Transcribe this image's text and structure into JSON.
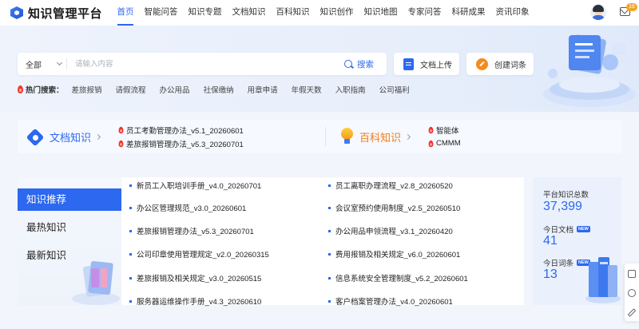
{
  "brand": {
    "name": "知识管理平台"
  },
  "nav": {
    "items": [
      {
        "label": "首页",
        "active": true
      },
      {
        "label": "智能问答"
      },
      {
        "label": "知识专题"
      },
      {
        "label": "文档知识"
      },
      {
        "label": "百科知识"
      },
      {
        "label": "知识创作"
      },
      {
        "label": "知识地图"
      },
      {
        "label": "专家问答"
      },
      {
        "label": "科研成果"
      },
      {
        "label": "资讯印象"
      }
    ]
  },
  "header": {
    "mail_badge": "16"
  },
  "search": {
    "category": "全部",
    "placeholder": "请输入内容",
    "button_label": "搜索"
  },
  "actions": {
    "upload_label": "文档上传",
    "create_label": "创建词条"
  },
  "hot": {
    "label": "热门搜索：",
    "tags": [
      "差旅报销",
      "请假流程",
      "办公用品",
      "社保缴纳",
      "用章申请",
      "年假天数",
      "入职指南",
      "公司福利"
    ]
  },
  "doc_knowledge": {
    "title": "文档知识",
    "items": [
      "员工考勤管理办法_v5.1_20260601",
      "差旅报销管理办法_v5.3_20260701"
    ]
  },
  "baike_knowledge": {
    "title": "百科知识",
    "items": [
      "智能体",
      "CMMM"
    ]
  },
  "tabs": [
    "知识推荐",
    "最热知识",
    "最新知识"
  ],
  "docs": {
    "left": [
      "新员工入职培训手册_v4.0_20260701",
      "办公区管理规范_v3.0_20260601",
      "差旅报销管理办法_v5.3_20260701",
      "公司印章使用管理规定_v2.0_20260315",
      "差旅报销及相关规定_v3.0_20260515",
      "服务器运维操作手册_v4.3_20260610"
    ],
    "right": [
      "员工离职办理流程_v2.8_20260520",
      "会议室预约使用制度_v2.5_20260510",
      "办公用品申领流程_v3.1_20260420",
      "费用报销及相关规定_v6.0_20260601",
      "信息系统安全管理制度_v5.2_20260601",
      "客户档案管理办法_v4.0_20260601"
    ]
  },
  "stats": {
    "total_label": "平台知识总数",
    "total_value": "37,399",
    "docs_label": "今日文档",
    "docs_value": "41",
    "terms_label": "今日词条",
    "terms_value": "13",
    "new_badge": "NEW"
  },
  "colors": {
    "primary": "#2c68f0",
    "accent_orange": "#f07d1b",
    "hot_red": "#f0352f"
  }
}
